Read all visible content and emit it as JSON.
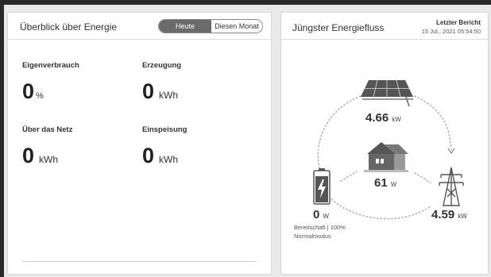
{
  "overview": {
    "title": "Überblick über Energie",
    "toggle": [
      {
        "label": "Heute",
        "active": true
      },
      {
        "label": "Diesen Monat",
        "active": false
      }
    ],
    "metrics": {
      "self_consumption": {
        "label": "Eigenverbrauch",
        "value": "0",
        "unit": "%"
      },
      "generation": {
        "label": "Erzeugung",
        "value": "0",
        "unit": "kWh"
      },
      "grid": {
        "label": "Über das Netz",
        "value": "0",
        "unit": "kWh"
      },
      "feed_in": {
        "label": "Einspeisung",
        "value": "0",
        "unit": "kWh"
      }
    }
  },
  "flow": {
    "title": "Jüngster Energiefluss",
    "report_label": "Letzter Bericht",
    "report_time": "15 Jul., 2021 05:54:50",
    "solar": {
      "value": "4.66",
      "unit": "kW",
      "icon": "solar-panel-icon"
    },
    "home": {
      "value": "61",
      "unit": "W",
      "icon": "house-icon"
    },
    "battery": {
      "value": "0",
      "unit": "W",
      "icon": "battery-icon",
      "status": "Bereitschaft | 100%",
      "mode": "Normalmodus"
    },
    "grid": {
      "value": "4.59",
      "unit": "kW",
      "icon": "power-pylon-icon"
    }
  },
  "colors": {
    "toggle_active": "#6b6b6b",
    "flow_dots": "#aaaaaa",
    "panel_border": "#d8d8d8"
  }
}
